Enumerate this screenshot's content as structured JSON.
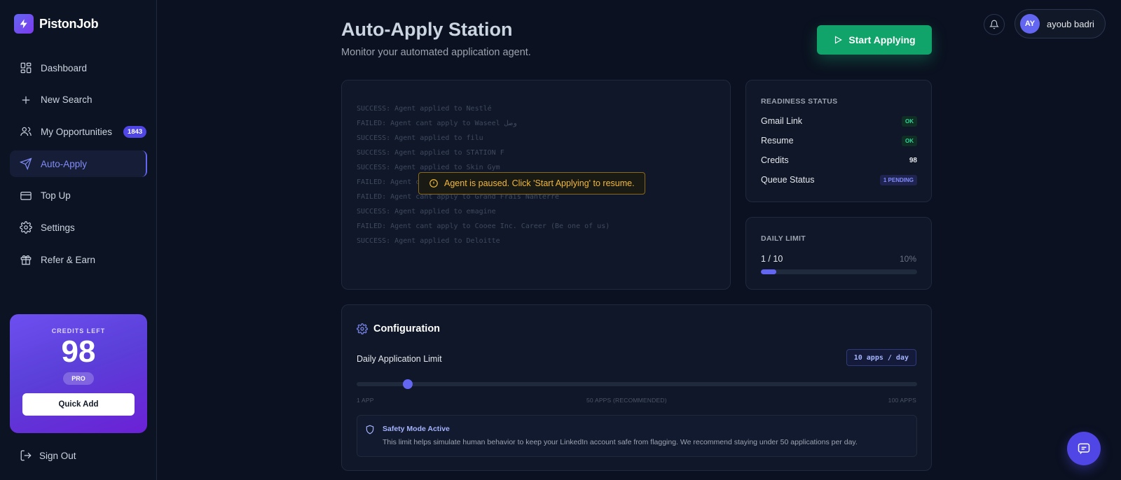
{
  "app": {
    "name": "PistonJob"
  },
  "sidebar": {
    "items": [
      {
        "label": "Dashboard",
        "icon": "dashboard-icon"
      },
      {
        "label": "New Search",
        "icon": "plus-icon"
      },
      {
        "label": "My Opportunities",
        "icon": "users-icon",
        "badge": "1843"
      },
      {
        "label": "Auto-Apply",
        "icon": "send-icon",
        "active": true
      },
      {
        "label": "Top Up",
        "icon": "credit-card-icon"
      },
      {
        "label": "Settings",
        "icon": "gear-icon"
      },
      {
        "label": "Refer & Earn",
        "icon": "gift-icon"
      }
    ],
    "credits": {
      "label": "CREDITS LEFT",
      "value": "98",
      "plan": "PRO",
      "quick_add_label": "Quick Add"
    },
    "sign_out_label": "Sign Out"
  },
  "header": {
    "title": "Auto-Apply Station",
    "subtitle": "Monitor your automated application agent.",
    "start_label": "Start Applying",
    "user": {
      "initials": "AY",
      "name": "ayoub badri"
    }
  },
  "log": {
    "lines": [
      "SUCCESS: Agent applied to Nestlé",
      "FAILED: Agent cant apply to Waseel وصل",
      "SUCCESS: Agent applied to filu",
      "SUCCESS: Agent applied to STATION F",
      "SUCCESS: Agent applied to Skin Gym",
      "FAILED: Agent cant apply to ...",
      "FAILED: Agent cant apply to Grand Frais Nanterre",
      "SUCCESS: Agent applied to emagine",
      "FAILED: Agent cant apply to Cooee Inc. Career (Be one of us)",
      "SUCCESS: Agent applied to Deloitte"
    ],
    "pause_message": "Agent is paused. Click 'Start Applying' to resume."
  },
  "readiness": {
    "title": "READINESS STATUS",
    "rows": [
      {
        "label": "Gmail Link",
        "value": "OK"
      },
      {
        "label": "Resume",
        "value": "OK"
      },
      {
        "label": "Credits",
        "value": "98"
      },
      {
        "label": "Queue Status",
        "value": "1 PENDING"
      }
    ]
  },
  "daily_limit": {
    "title": "DAILY LIMIT",
    "count": "1 / 10",
    "percent_label": "10%",
    "fraction": 0.1
  },
  "configuration": {
    "title": "Configuration",
    "limit_label": "Daily Application Limit",
    "limit_value_label": "10 apps / day",
    "slider": {
      "min": 1,
      "max": 100,
      "value": 10
    },
    "min_label": "1 APP",
    "mid_label": "50 APPS (RECOMMENDED)",
    "max_label": "100 APPS",
    "safety_title": "Safety Mode Active",
    "safety_text": "This limit helps simulate human behavior to keep your LinkedIn account safe from flagging. We recommend staying under 50 applications per day."
  },
  "colors": {
    "accent": "#6366f1",
    "success": "#10a36a",
    "warning": "#f2b838",
    "background": "#0b1120"
  }
}
